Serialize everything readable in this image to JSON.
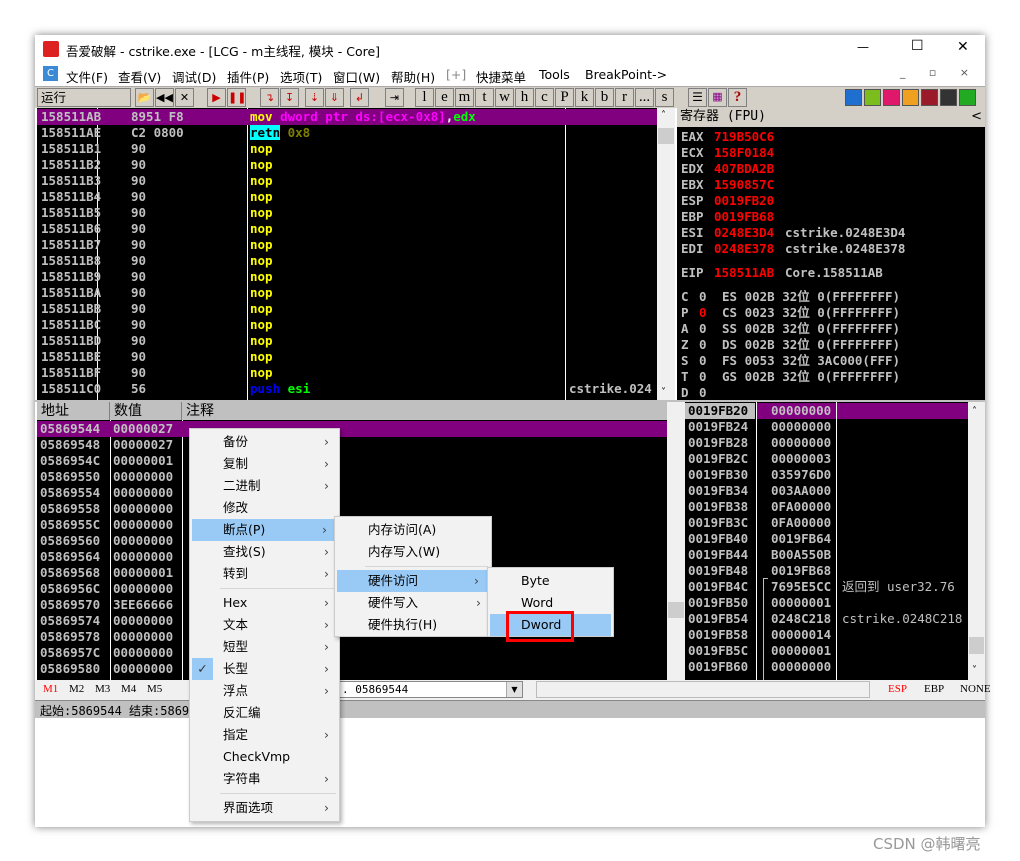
{
  "title": "吾爱破解 - cstrike.exe - [LCG - m主线程, 模块 - Core]",
  "window_controls": {
    "minimize": "—",
    "maximize": "☐",
    "close": "✕"
  },
  "menu": [
    "文件(F)",
    "查看(V)",
    "调试(D)",
    "插件(P)",
    "选项(T)",
    "窗口(W)",
    "帮助(H)",
    "[+]",
    "快捷菜单",
    "Tools",
    "BreakPoint->"
  ],
  "status_run": "运行",
  "toolbar_letters": [
    "l",
    "e",
    "m",
    "t",
    "w",
    "h",
    "c",
    "P",
    "k",
    "b",
    "r",
    "...",
    "s"
  ],
  "toolbar_help": "?",
  "disasm": [
    {
      "addr": "158511AB",
      "hex": "8951 F8",
      "ins": [
        [
          "mov ",
          "#ffff00"
        ],
        [
          "dword ptr ds:[ecx-0x8]",
          "#ff00ff"
        ],
        [
          ",",
          "#ffffff"
        ],
        [
          "edx",
          "#00ff00"
        ]
      ],
      "comment": "",
      "selected": true
    },
    {
      "addr": "158511AE",
      "hex": "C2 0800",
      "ins": [
        [
          "retn",
          "#000000",
          "#00ffff"
        ],
        [
          " 0x8",
          "#808000"
        ]
      ],
      "comment": ""
    },
    {
      "addr": "158511B1",
      "hex": "90",
      "ins": [
        [
          "nop",
          "#ffff00"
        ]
      ],
      "comment": ""
    },
    {
      "addr": "158511B2",
      "hex": "90",
      "ins": [
        [
          "nop",
          "#ffff00"
        ]
      ],
      "comment": ""
    },
    {
      "addr": "158511B3",
      "hex": "90",
      "ins": [
        [
          "nop",
          "#ffff00"
        ]
      ],
      "comment": ""
    },
    {
      "addr": "158511B4",
      "hex": "90",
      "ins": [
        [
          "nop",
          "#ffff00"
        ]
      ],
      "comment": ""
    },
    {
      "addr": "158511B5",
      "hex": "90",
      "ins": [
        [
          "nop",
          "#ffff00"
        ]
      ],
      "comment": ""
    },
    {
      "addr": "158511B6",
      "hex": "90",
      "ins": [
        [
          "nop",
          "#ffff00"
        ]
      ],
      "comment": ""
    },
    {
      "addr": "158511B7",
      "hex": "90",
      "ins": [
        [
          "nop",
          "#ffff00"
        ]
      ],
      "comment": ""
    },
    {
      "addr": "158511B8",
      "hex": "90",
      "ins": [
        [
          "nop",
          "#ffff00"
        ]
      ],
      "comment": ""
    },
    {
      "addr": "158511B9",
      "hex": "90",
      "ins": [
        [
          "nop",
          "#ffff00"
        ]
      ],
      "comment": ""
    },
    {
      "addr": "158511BA",
      "hex": "90",
      "ins": [
        [
          "nop",
          "#ffff00"
        ]
      ],
      "comment": ""
    },
    {
      "addr": "158511BB",
      "hex": "90",
      "ins": [
        [
          "nop",
          "#ffff00"
        ]
      ],
      "comment": ""
    },
    {
      "addr": "158511BC",
      "hex": "90",
      "ins": [
        [
          "nop",
          "#ffff00"
        ]
      ],
      "comment": ""
    },
    {
      "addr": "158511BD",
      "hex": "90",
      "ins": [
        [
          "nop",
          "#ffff00"
        ]
      ],
      "comment": ""
    },
    {
      "addr": "158511BE",
      "hex": "90",
      "ins": [
        [
          "nop",
          "#ffff00"
        ]
      ],
      "comment": ""
    },
    {
      "addr": "158511BF",
      "hex": "90",
      "ins": [
        [
          "nop",
          "#ffff00"
        ]
      ],
      "comment": ""
    },
    {
      "addr": "158511C0",
      "hex": "56",
      "ins": [
        [
          "push ",
          "#0000ff"
        ],
        [
          "esi",
          "#00ff00"
        ]
      ],
      "comment": "cstrike.024"
    }
  ],
  "registers": {
    "title": "寄存器 (FPU)",
    "collapse": "<",
    "gp": [
      [
        "EAX",
        "719B50C6",
        ""
      ],
      [
        "ECX",
        "158F0184",
        ""
      ],
      [
        "EDX",
        "407BDA2B",
        ""
      ],
      [
        "EBX",
        "1590857C",
        ""
      ],
      [
        "ESP",
        "0019FB20",
        ""
      ],
      [
        "EBP",
        "0019FB68",
        ""
      ],
      [
        "ESI",
        "0248E3D4",
        "cstrike.0248E3D4"
      ],
      [
        "EDI",
        "0248E378",
        "cstrike.0248E378"
      ]
    ],
    "eip": [
      "EIP",
      "158511AB",
      "Core.158511AB"
    ],
    "flags": [
      [
        "C",
        "0",
        "ES 002B 32位 0(FFFFFFFF)"
      ],
      [
        "P",
        "0",
        "CS 0023 32位 0(FFFFFFFF)"
      ],
      [
        "A",
        "0",
        "SS 002B 32位 0(FFFFFFFF)"
      ],
      [
        "Z",
        "0",
        "DS 002B 32位 0(FFFFFFFF)"
      ],
      [
        "S",
        "0",
        "FS 0053 32位 3AC000(FFF)"
      ],
      [
        "T",
        "0",
        "GS 002B 32位 0(FFFFFFFF)"
      ],
      [
        "D",
        "0",
        ""
      ]
    ]
  },
  "dump": {
    "headers": [
      "地址",
      "数值",
      "注释"
    ],
    "rows": [
      [
        "05869544",
        "00000027"
      ],
      [
        "05869548",
        "00000027"
      ],
      [
        "0586954C",
        "00000001"
      ],
      [
        "05869550",
        "00000000"
      ],
      [
        "05869554",
        "00000000"
      ],
      [
        "05869558",
        "00000000"
      ],
      [
        "0586955C",
        "00000000"
      ],
      [
        "05869560",
        "00000000"
      ],
      [
        "05869564",
        "00000000"
      ],
      [
        "05869568",
        "00000001"
      ],
      [
        "0586956C",
        "00000000"
      ],
      [
        "05869570",
        "3EE66666"
      ],
      [
        "05869574",
        "00000000"
      ],
      [
        "05869578",
        "00000000"
      ],
      [
        "0586957C",
        "00000000"
      ],
      [
        "05869580",
        "00000000"
      ]
    ]
  },
  "stack": [
    [
      "0019FB20",
      "00000000",
      ""
    ],
    [
      "0019FB24",
      "00000000",
      ""
    ],
    [
      "0019FB28",
      "00000000",
      ""
    ],
    [
      "0019FB2C",
      "00000003",
      ""
    ],
    [
      "0019FB30",
      "035976D0",
      ""
    ],
    [
      "0019FB34",
      "003AA000",
      ""
    ],
    [
      "0019FB38",
      "0FA00000",
      ""
    ],
    [
      "0019FB3C",
      "0FA00000",
      ""
    ],
    [
      "0019FB40",
      "0019FB64",
      ""
    ],
    [
      "0019FB44",
      "B00A550B",
      ""
    ],
    [
      "0019FB48",
      "0019FB68",
      ""
    ],
    [
      "0019FB4C",
      "7695E5CC",
      "返回到 user32.76"
    ],
    [
      "0019FB50",
      "00000001",
      ""
    ],
    [
      "0019FB54",
      "0248C218",
      "cstrike.0248C218"
    ],
    [
      "0019FB58",
      "00000014",
      ""
    ],
    [
      "0019FB5C",
      "00000001",
      ""
    ],
    [
      "0019FB60",
      "00000000",
      ""
    ]
  ],
  "memtabs": [
    "M1",
    "M2",
    "M3",
    "M4",
    "M5"
  ],
  "command_input": ". 05869544",
  "stack_modes": [
    "ESP",
    "EBP",
    "NONE"
  ],
  "status_bar": "起始:5869544 结束:5869",
  "context_menu": {
    "items": [
      {
        "label": "备份",
        "sub": true
      },
      {
        "label": "复制",
        "sub": true
      },
      {
        "label": "二进制",
        "sub": true
      },
      {
        "label": "修改",
        "sub": false
      },
      {
        "label": "断点(P)",
        "sub": true,
        "active": true
      },
      {
        "label": "查找(S)",
        "sub": true
      },
      {
        "label": "转到",
        "sub": true
      },
      {
        "label": "Hex",
        "sub": true
      },
      {
        "label": "文本",
        "sub": true
      },
      {
        "label": "短型",
        "sub": true
      },
      {
        "label": "长型",
        "sub": true,
        "checked": true
      },
      {
        "label": "浮点",
        "sub": true
      },
      {
        "label": "反汇编",
        "sub": false
      },
      {
        "label": "指定",
        "sub": true
      },
      {
        "label": "CheckVmp",
        "sub": false
      },
      {
        "label": "字符串",
        "sub": true
      },
      {
        "label": "界面选项",
        "sub": true
      }
    ]
  },
  "breakpoint_menu": [
    {
      "label": "内存访问(A)",
      "sub": false
    },
    {
      "label": "内存写入(W)",
      "sub": false
    },
    {
      "label": "硬件访问",
      "sub": true,
      "active": true
    },
    {
      "label": "硬件写入",
      "sub": true
    },
    {
      "label": "硬件执行(H)",
      "sub": false
    }
  ],
  "hw_access_menu": [
    {
      "label": "Byte"
    },
    {
      "label": "Word"
    },
    {
      "label": "Dword",
      "active": true,
      "boxed": true
    }
  ],
  "watermark": "CSDN @韩曙亮",
  "colors": {
    "selection": "#800080",
    "menu_highlight": "#99c9f5",
    "register_value": "#ff0000",
    "annotation_box": "#ff0000"
  }
}
